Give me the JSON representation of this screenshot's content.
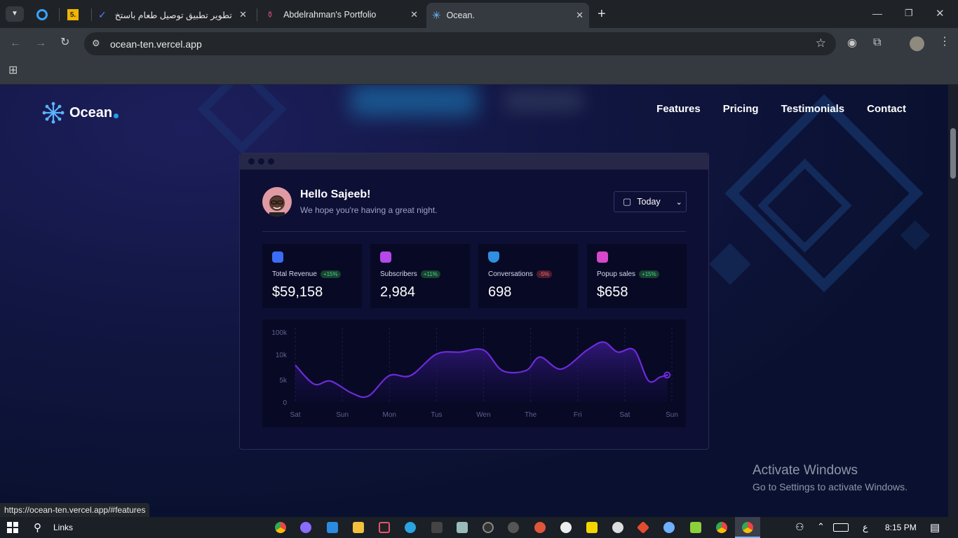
{
  "browser": {
    "tabs": [
      {
        "title": ""
      },
      {
        "title": "5."
      },
      {
        "title": "تطوير تطبيق توصيل طعام باستخ"
      },
      {
        "title": "Abdelrahman's Portfolio"
      },
      {
        "title": "Ocean."
      }
    ],
    "new_tab": "+",
    "url": "ocean-ten.vercel.app",
    "status_url": "https://ocean-ten.vercel.app/#features"
  },
  "nav": {
    "logo_text": "Ocean",
    "links": [
      "Features",
      "Pricing",
      "Testimonials",
      "Contact"
    ]
  },
  "dashboard": {
    "greeting": "Hello Sajeeb!",
    "subtitle": "We hope you're having a great night.",
    "date_filter": "Today",
    "stats": [
      {
        "label": "Total Revenue",
        "change": "+15%",
        "direction": "up",
        "value": "$59,158",
        "icon_color": "#3b6cf5"
      },
      {
        "label": "Subscribers",
        "change": "+11%",
        "direction": "up",
        "value": "2,984",
        "icon_color": "#b548e8"
      },
      {
        "label": "Conversations",
        "change": "-5%",
        "direction": "down",
        "value": "698",
        "icon_color": "#2f8fe0"
      },
      {
        "label": "Popup sales",
        "change": "+15%",
        "direction": "up",
        "value": "$658",
        "icon_color": "#d548c9"
      }
    ]
  },
  "chart_data": {
    "type": "area",
    "x": [
      "Sat",
      "Sun",
      "Mon",
      "Tus",
      "Wen",
      "The",
      "Fri",
      "Sat",
      "Sun"
    ],
    "yticks": [
      "100k",
      "10k",
      "5k",
      "0"
    ],
    "points": [
      [
        0.0,
        7.4
      ],
      [
        0.4,
        3.6
      ],
      [
        0.75,
        4.2
      ],
      [
        1.2,
        1.8
      ],
      [
        1.55,
        1.2
      ],
      [
        2.0,
        5.3
      ],
      [
        2.45,
        5.3
      ],
      [
        3.0,
        9.6
      ],
      [
        3.5,
        10.0
      ],
      [
        4.0,
        10.4
      ],
      [
        4.4,
        6.3
      ],
      [
        4.9,
        6.3
      ],
      [
        5.2,
        9.0
      ],
      [
        5.65,
        6.6
      ],
      [
        6.2,
        10.4
      ],
      [
        6.55,
        12.0
      ],
      [
        6.85,
        10.0
      ],
      [
        7.2,
        10.4
      ],
      [
        7.5,
        4.3
      ],
      [
        7.75,
        5.0
      ],
      [
        7.9,
        5.4
      ]
    ],
    "line_color": "#6c2bd9",
    "grid": true,
    "legend": "none"
  },
  "windows": {
    "activate_title": "Activate Windows",
    "activate_sub": "Go to Settings to activate Windows.",
    "search_label": "Links",
    "time": "8:15 PM",
    "lang": "ع"
  }
}
